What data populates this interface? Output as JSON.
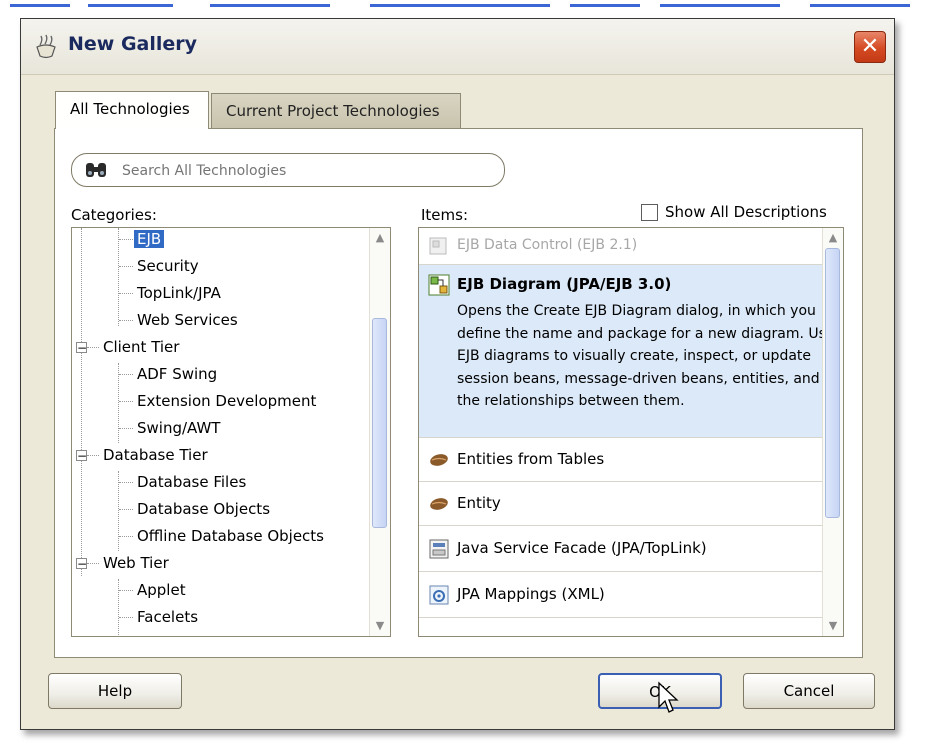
{
  "window": {
    "title": "New Gallery"
  },
  "tabs": [
    {
      "label": "All Technologies",
      "active": true
    },
    {
      "label": "Current Project Technologies",
      "active": false
    }
  ],
  "search": {
    "placeholder": "Search All Technologies"
  },
  "categories": {
    "label": "Categories:",
    "items": [
      {
        "label": "EJB",
        "selected": true
      },
      {
        "label": "Security"
      },
      {
        "label": "TopLink/JPA"
      },
      {
        "label": "Web Services"
      },
      {
        "label": "Client Tier",
        "group": true
      },
      {
        "label": "ADF Swing"
      },
      {
        "label": "Extension Development"
      },
      {
        "label": "Swing/AWT"
      },
      {
        "label": "Database Tier",
        "group": true
      },
      {
        "label": "Database Files"
      },
      {
        "label": "Database Objects"
      },
      {
        "label": "Offline Database Objects"
      },
      {
        "label": "Web Tier",
        "group": true
      },
      {
        "label": "Applet"
      },
      {
        "label": "Facelets"
      }
    ]
  },
  "items": {
    "label": "Items:",
    "show_all_label": "Show All Descriptions",
    "list": [
      {
        "title": "EJB Data Control (EJB 2.1)",
        "disabled": true,
        "icon": "ejb-data-control-icon"
      },
      {
        "title": "EJB Diagram (JPA/EJB 3.0)",
        "selected": true,
        "icon": "ejb-diagram-icon",
        "description": "Opens the Create EJB Diagram dialog, in which you define the name and package for a new diagram. Use EJB diagrams to visually create, inspect, or update session beans, message-driven beans, entities, and the relationships between them."
      },
      {
        "title": "Entities from Tables",
        "icon": "bean-icon"
      },
      {
        "title": "Entity",
        "icon": "bean-icon"
      },
      {
        "title": "Java Service Facade (JPA/TopLink)",
        "icon": "service-facade-icon"
      },
      {
        "title": "JPA Mappings (XML)",
        "icon": "xml-mapping-icon"
      }
    ]
  },
  "buttons": {
    "help": "Help",
    "ok": "OK",
    "cancel": "Cancel"
  },
  "colors": {
    "selection": "#316ac5",
    "item_selected_bg": "#dce9f8",
    "dialog_bg": "#ece9d8",
    "close": "#d44a22"
  }
}
